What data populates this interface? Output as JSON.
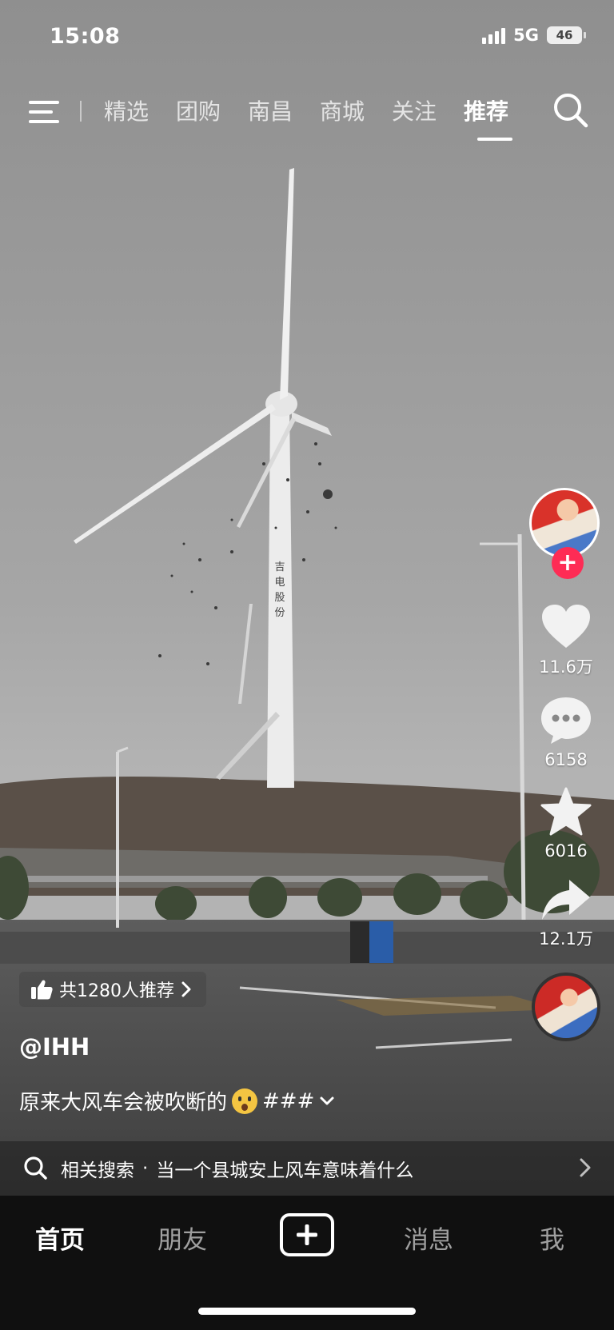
{
  "status_bar": {
    "time": "15:08",
    "network": "5G",
    "battery": "46"
  },
  "top_nav": {
    "tabs": [
      {
        "label": "精选"
      },
      {
        "label": "团购"
      },
      {
        "label": "南昌"
      },
      {
        "label": "商城"
      },
      {
        "label": "关注"
      },
      {
        "label": "推荐"
      }
    ],
    "active_tab": "推荐"
  },
  "video": {
    "turbine_text": "吉电股份"
  },
  "right_rail": {
    "likes": "11.6万",
    "comments": "6158",
    "favorites": "6016",
    "shares": "12.1万"
  },
  "recommend": {
    "text": "共1280人推荐"
  },
  "author": {
    "handle": "@IHH"
  },
  "caption": {
    "text_before": "原来大风车会被吹断的",
    "text_after": "###"
  },
  "related_search": {
    "prefix": "相关搜索",
    "separator": "·",
    "query": "当一个县城安上风车意味着什么"
  },
  "bottom_tabs": {
    "home": "首页",
    "friends": "朋友",
    "messages": "消息",
    "me": "我"
  },
  "colors": {
    "accent": "#fe2c55",
    "tabbar_bg": "#101010"
  }
}
